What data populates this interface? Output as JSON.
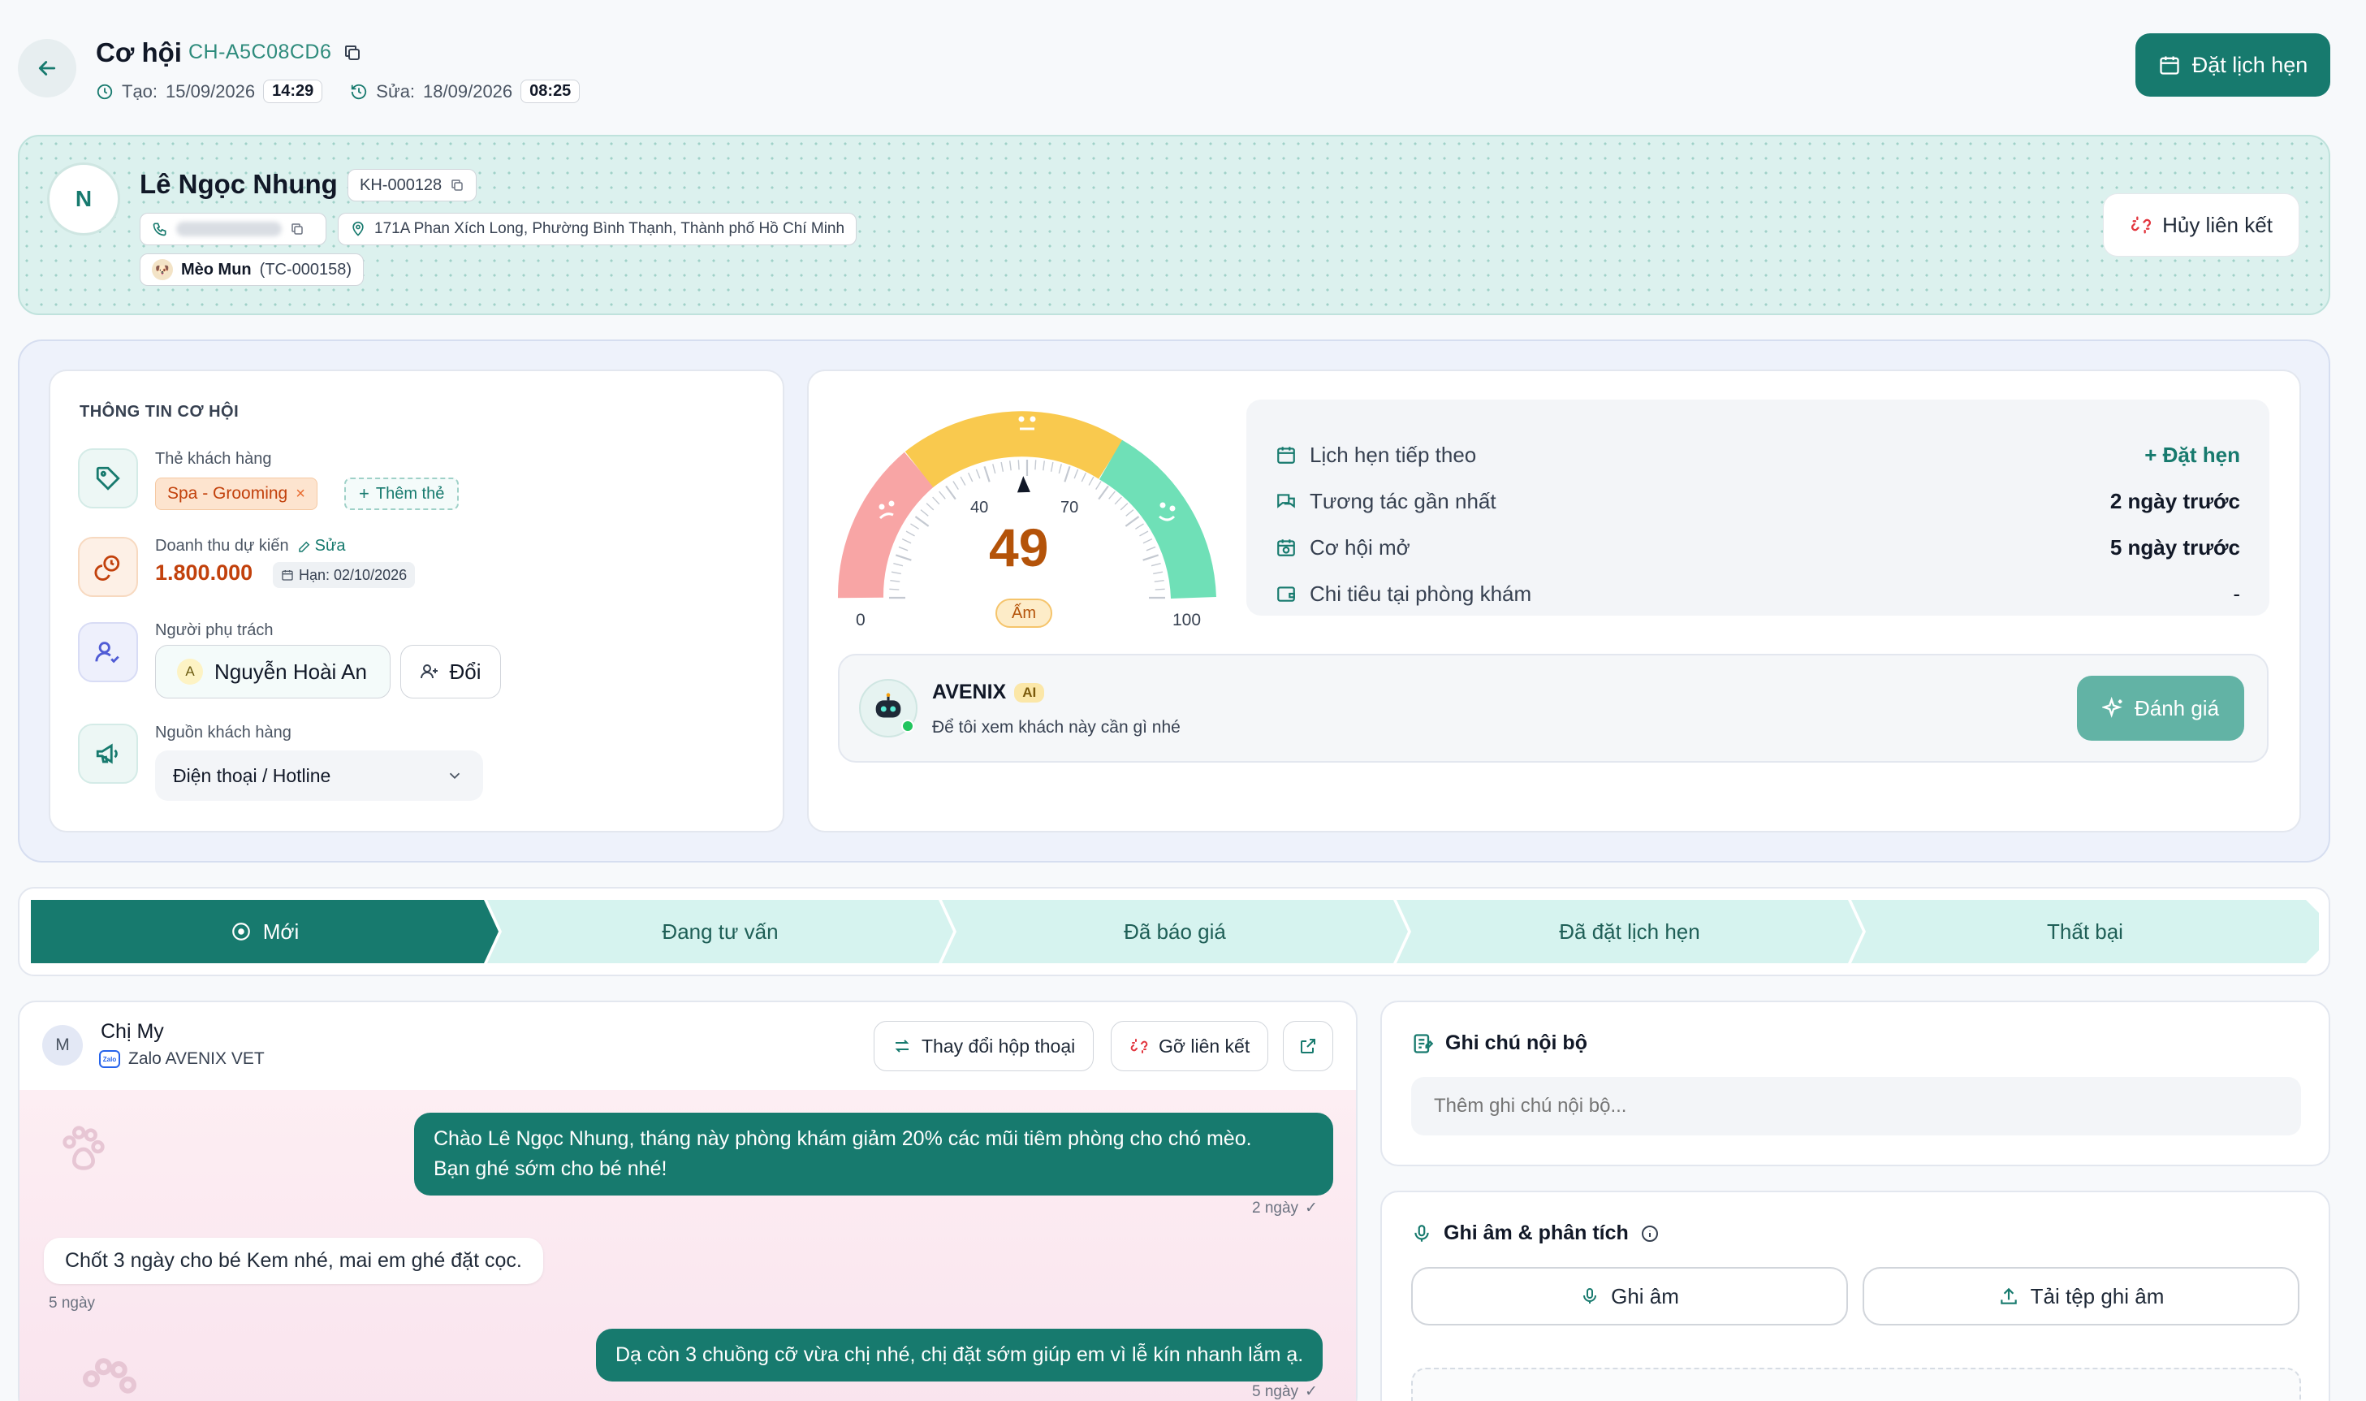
{
  "header": {
    "title": "Cơ hội",
    "code": "CH-A5C08CD6",
    "created_label": "Tạo:",
    "created_date": "15/09/2026",
    "created_time": "14:29",
    "edited_label": "Sửa:",
    "edited_date": "18/09/2026",
    "edited_time": "08:25",
    "book_button": "Đặt lịch hẹn"
  },
  "customer": {
    "initial": "N",
    "name": "Lê Ngọc Nhung",
    "code": "KH-000128",
    "address": "171A Phan Xích Long, Phường Bình Thạnh, Thành phố Hồ Chí Minh",
    "pet_name": "Mèo Mun",
    "pet_code": "(TC-000158)",
    "unlink_button": "Hủy liên kết"
  },
  "info": {
    "section_title": "THÔNG TIN CƠ HỘI",
    "tags_label": "Thẻ khách hàng",
    "tag": "Spa - Grooming",
    "add_tag": "Thêm thẻ",
    "revenue_label": "Doanh thu dự kiến",
    "edit_label": "Sửa",
    "revenue_value": "1.800.000",
    "deadline": "Hạn: 02/10/2026",
    "owner_label": "Người phụ trách",
    "owner_initial": "A",
    "owner_name": "Nguyễn Hoài An",
    "change_button": "Đổi",
    "source_label": "Nguồn khách hàng",
    "source_value": "Điện thoại / Hotline"
  },
  "gauge": {
    "score": "49",
    "score_value": 49,
    "status": "Ấm",
    "min": "0",
    "max": "100",
    "mark1": "40",
    "mark2": "70",
    "colors": {
      "cold": "#f8a5a5",
      "warm": "#f9c94e",
      "hot": "#6fe0b7"
    }
  },
  "stats": [
    {
      "label": "Lịch hẹn tiếp theo",
      "value": "+ Đặt hẹn",
      "icon": "calendar-icon"
    },
    {
      "label": "Tương tác gần nhất",
      "value": "2 ngày trước",
      "icon": "chat-icon"
    },
    {
      "label": "Cơ hội mở",
      "value": "5 ngày trước",
      "icon": "calendar-clock-icon"
    },
    {
      "label": "Chi tiêu tại phòng khám",
      "value": "-",
      "icon": "wallet-icon"
    }
  ],
  "ai": {
    "name": "AVENIX",
    "badge": "AI",
    "subtitle": "Để tôi xem khách này cần gì nhé",
    "button": "Đánh giá"
  },
  "pipeline": [
    {
      "label": "Mới",
      "active": true
    },
    {
      "label": "Đang tư vấn",
      "active": false
    },
    {
      "label": "Đã báo giá",
      "active": false
    },
    {
      "label": "Đã đặt lịch hẹn",
      "active": false
    },
    {
      "label": "Thất bại",
      "active": false
    }
  ],
  "chat": {
    "initial": "M",
    "contact": "Chị My",
    "channel": "Zalo AVENIX VET",
    "change_button": "Thay đổi hộp thoại",
    "unlink_button": "Gỡ liên kết",
    "messages": [
      {
        "dir": "out",
        "line1": "Chào Lê Ngọc Nhung, tháng này phòng khám giảm 20% các mũi tiêm phòng cho chó mèo.",
        "line2": "Bạn ghé sớm cho bé nhé!",
        "time": "2 ngày"
      },
      {
        "dir": "in",
        "text": "Chốt 3 ngày cho bé Kem nhé, mai em ghé đặt cọc.",
        "time": "5 ngày"
      },
      {
        "dir": "out",
        "text": "Dạ còn 3 chuồng cỡ vừa chị nhé, chị đặt sớm giúp em vì lễ kín nhanh lắm ạ.",
        "time": "5 ngày"
      }
    ]
  },
  "notes": {
    "title": "Ghi chú nội bộ",
    "placeholder": "Thêm ghi chú nội bộ..."
  },
  "recording": {
    "title": "Ghi âm & phân tích",
    "record_button": "Ghi âm",
    "upload_button": "Tải tệp ghi âm"
  }
}
